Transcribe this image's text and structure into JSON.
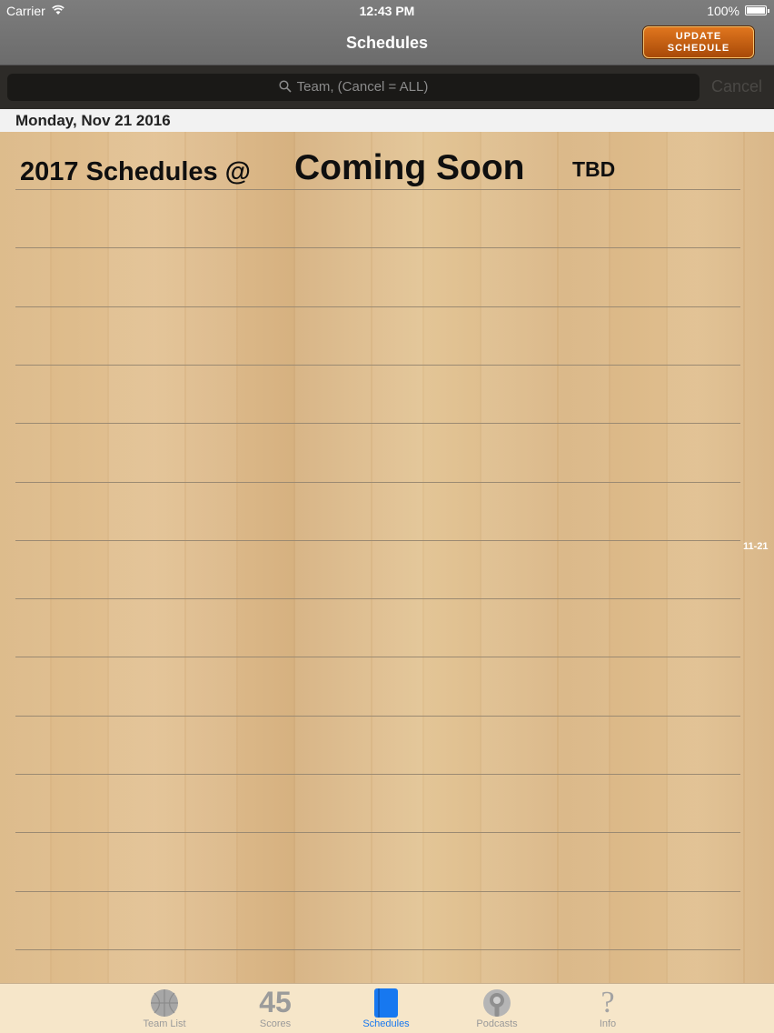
{
  "status_bar": {
    "carrier": "Carrier",
    "time": "12:43 PM",
    "battery": "100%"
  },
  "nav": {
    "title": "Schedules",
    "update_button_line1": "Update",
    "update_button_line2": "SChedule"
  },
  "search": {
    "placeholder": "Team, (Cancel = ALL)",
    "cancel_label": "Cancel"
  },
  "date_header": "Monday, Nov 21 2016",
  "games": [
    {
      "title": "2017 Schedules @",
      "opponent": "Coming Soon",
      "time": "TBD"
    }
  ],
  "section_index": [
    "11-21"
  ],
  "tabs": [
    {
      "label": "Team List",
      "icon": "basketball-icon"
    },
    {
      "label": "Scores",
      "icon": "scores-icon",
      "icon_text": "45"
    },
    {
      "label": "Schedules",
      "icon": "schedule-book-icon"
    },
    {
      "label": "Podcasts",
      "icon": "podcast-icon"
    },
    {
      "label": "Info",
      "icon": "question-mark-icon",
      "icon_text": "?"
    }
  ],
  "active_tab": "Schedules",
  "colors": {
    "active_tab": "#1778f0",
    "update_button": "#c2600f",
    "nav_bar": "#757575"
  }
}
